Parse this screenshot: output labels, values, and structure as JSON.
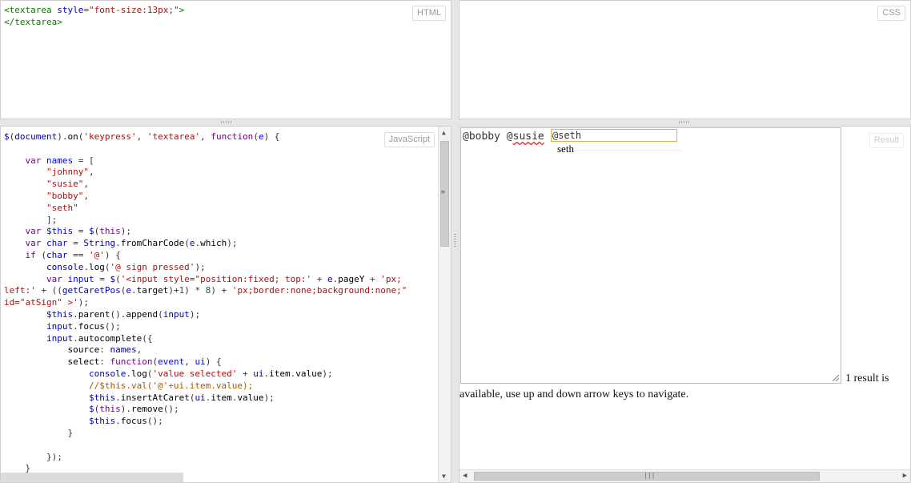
{
  "panels": {
    "html_label": "HTML",
    "css_label": "CSS",
    "js_label": "JavaScript",
    "result_label": "Result"
  },
  "html_code": [
    "<textarea style=\"font-size:13px;\">",
    "</textarea>"
  ],
  "js_code": [
    "$(document).on('keypress', 'textarea', function(e) {",
    "",
    "    var names = [",
    "        \"johnny\",",
    "        \"susie\",",
    "        \"bobby\",",
    "        \"seth\"",
    "        ];",
    "    var $this = $(this);",
    "    var char = String.fromCharCode(e.which);",
    "    if (char == '@') {",
    "        console.log('@ sign pressed');",
    "        var input = $('<input style=\"position:fixed; top:' + e.pageY + 'px;",
    "left:' + ((getCaretPos(e.target)+1) * 8) + 'px;border:none;background:none;\"",
    "id=\"atSign\" >');",
    "        $this.parent().append(input);",
    "        input.focus();",
    "        input.autocomplete({",
    "            source: names,",
    "            select: function(event, ui) {",
    "                console.log('value selected' + ui.item.value);",
    "                //$this.val('@'+ui.item.value);",
    "                $this.insertAtCaret(ui.item.value);",
    "                $(this).remove();",
    "                $this.focus();",
    "            }",
    "",
    "        });",
    "    }"
  ],
  "result": {
    "textarea_text_a": "@bobby @",
    "textarea_text_b": "susie",
    "textarea_text_c": " ",
    "input_value": "@seth",
    "suggestion": "seth",
    "live_region_line1": "1 result is",
    "live_region_line2": "available, use up and down arrow keys to navigate."
  }
}
